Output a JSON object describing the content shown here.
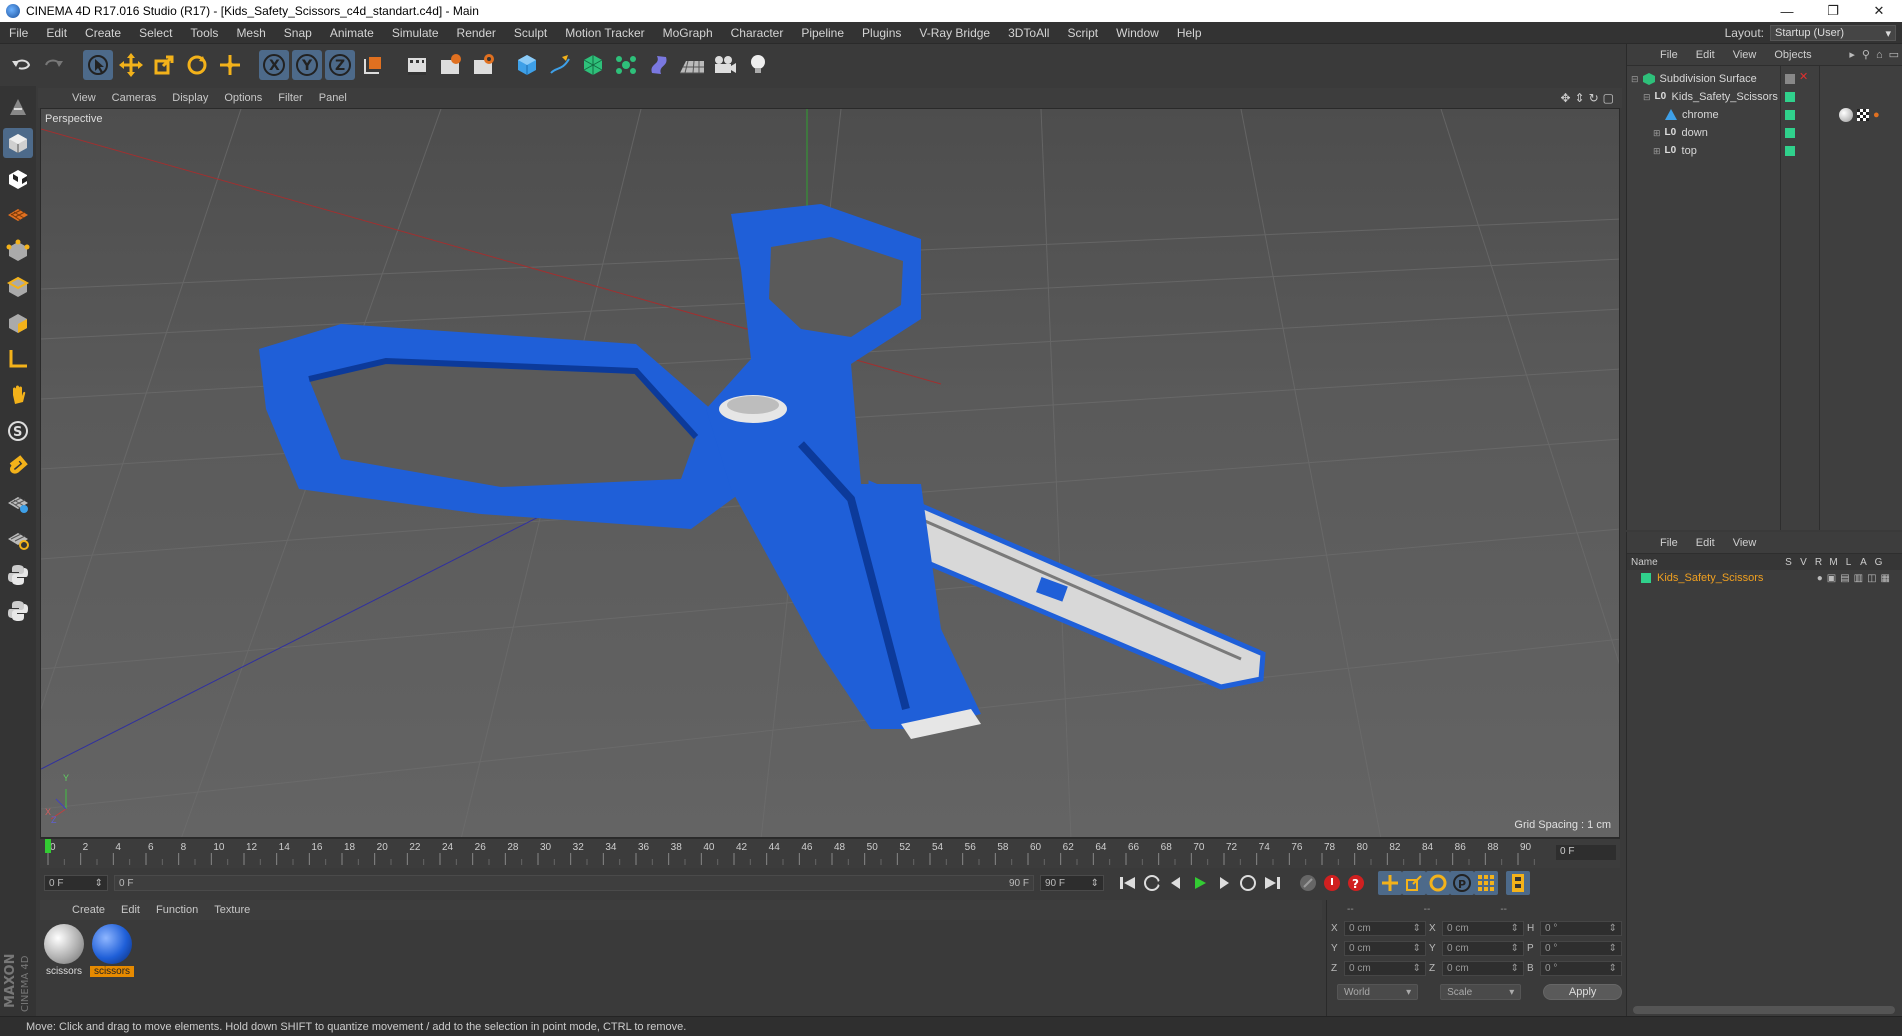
{
  "window": {
    "title": "CINEMA 4D R17.016 Studio (R17) - [Kids_Safety_Scissors_c4d_standart.c4d] - Main",
    "minimize": "—",
    "restore": "❐",
    "close": "✕"
  },
  "menubar": {
    "items": [
      "File",
      "Edit",
      "Create",
      "Select",
      "Tools",
      "Mesh",
      "Snap",
      "Animate",
      "Simulate",
      "Render",
      "Sculpt",
      "Motion Tracker",
      "MoGraph",
      "Character",
      "Pipeline",
      "Plugins",
      "V-Ray Bridge",
      "3DToAll",
      "Script",
      "Window",
      "Help"
    ],
    "layout_label": "Layout:",
    "layout_value": "Startup (User)"
  },
  "toolbar": {
    "icons": [
      "undo-icon",
      "redo-icon",
      "select-arrow-icon",
      "move-icon",
      "scale-icon",
      "rotate-icon",
      "live-transform-icon",
      "x-axis-lock-icon",
      "y-axis-lock-icon",
      "z-axis-lock-icon",
      "coordinate-system-icon",
      "render-view-icon",
      "render-picture-viewer-icon",
      "edit-render-settings-icon",
      "cube-primitive-icon",
      "spline-pen-icon",
      "subdivision-surface-icon",
      "cloner-icon",
      "deformer-icon",
      "floor-environment-icon",
      "camera-icon",
      "light-icon"
    ]
  },
  "left_tools": {
    "icons": [
      "make-editable-icon",
      "model-mode-icon",
      "texture-mode-icon",
      "workplane-mode-icon",
      "points-mode-icon",
      "edges-mode-icon",
      "polygons-mode-icon",
      "axis-mode-icon",
      "tweak-mode-icon",
      "solo-mode-icon",
      "snap-magnet-icon",
      "workplane-grid-icon",
      "workplane-lock-icon",
      "python-script-icon",
      "python-script-2-icon"
    ]
  },
  "viewport": {
    "menu": [
      "View",
      "Cameras",
      "Display",
      "Options",
      "Filter",
      "Panel"
    ],
    "label": "Perspective",
    "grid_spacing": "Grid Spacing : 1 cm",
    "axis_y": "Y",
    "axis_x": "X",
    "axis_z": "Z"
  },
  "timeline": {
    "ticks": [
      "0",
      "2",
      "4",
      "6",
      "8",
      "10",
      "12",
      "14",
      "16",
      "18",
      "20",
      "22",
      "24",
      "26",
      "28",
      "30",
      "32",
      "34",
      "36",
      "38",
      "40",
      "42",
      "44",
      "46",
      "48",
      "50",
      "52",
      "54",
      "56",
      "58",
      "60",
      "62",
      "64",
      "66",
      "68",
      "70",
      "72",
      "74",
      "76",
      "78",
      "80",
      "82",
      "84",
      "86",
      "88",
      "90"
    ],
    "current_frame": "0 F",
    "start_field": "0 F",
    "range_start": "0 F",
    "range_end": "90 F",
    "end_field": "90 F"
  },
  "materials": {
    "menu": [
      "Create",
      "Edit",
      "Function",
      "Texture"
    ],
    "items": [
      {
        "name": "scissors",
        "color": "#c8c8c8",
        "selected": false
      },
      {
        "name": "scissors",
        "color": "#1f5fd8",
        "selected": true
      }
    ]
  },
  "coordinates": {
    "headers": [
      "--",
      "--",
      "--"
    ],
    "rows": [
      {
        "a": "X",
        "v1": "0 cm",
        "b": "X",
        "v2": "0 cm",
        "c": "H",
        "v3": "0 °"
      },
      {
        "a": "Y",
        "v1": "0 cm",
        "b": "Y",
        "v2": "0 cm",
        "c": "P",
        "v3": "0 °"
      },
      {
        "a": "Z",
        "v1": "0 cm",
        "b": "Z",
        "v2": "0 cm",
        "c": "B",
        "v3": "0 °"
      }
    ],
    "world": "World",
    "scale": "Scale",
    "apply": "Apply"
  },
  "objects": {
    "menu": [
      "File",
      "Edit",
      "View",
      "Objects"
    ],
    "tree": [
      {
        "name": "Subdivision Surface",
        "indent": 0,
        "icon": "subdivision-surface-icon"
      },
      {
        "name": "Kids_Safety_Scissors",
        "indent": 1,
        "icon": "null-object-icon"
      },
      {
        "name": "chrome",
        "indent": 2,
        "icon": "polygon-object-icon"
      },
      {
        "name": "down",
        "indent": 2,
        "icon": "null-object-icon"
      },
      {
        "name": "top",
        "indent": 2,
        "icon": "null-object-icon"
      }
    ]
  },
  "attributes": {
    "menu": [
      "File",
      "Edit",
      "View"
    ],
    "header_name": "Name",
    "header_cols": [
      "S",
      "V",
      "R",
      "M",
      "L",
      "A",
      "G"
    ],
    "layer_name": "Kids_Safety_Scissors"
  },
  "status": {
    "text": "Move: Click and drag to move elements. Hold down SHIFT to quantize movement / add to the selection in point mode, CTRL to remove."
  },
  "colors": {
    "accent": "#4d6a8a",
    "layer_green": "#30d18c",
    "scissors_blue": "#1f5fd8",
    "selection_orange": "#e68a00"
  }
}
